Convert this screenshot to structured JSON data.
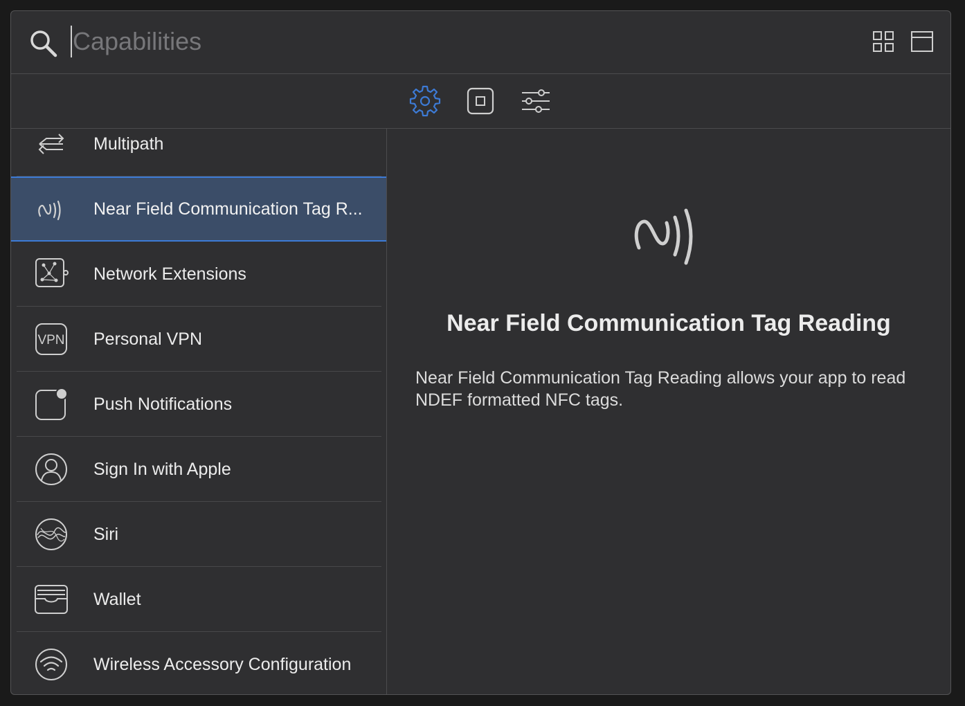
{
  "search": {
    "placeholder": "Capabilities",
    "value": ""
  },
  "toolbar": {
    "view_icons": [
      "grid-view-icon",
      "single-view-icon"
    ],
    "tabs": [
      {
        "name": "capabilities",
        "icon": "gear-icon",
        "active": true
      },
      {
        "name": "objects",
        "icon": "square-object-icon",
        "active": false
      },
      {
        "name": "attributes",
        "icon": "sliders-icon",
        "active": false
      }
    ]
  },
  "capabilities": [
    {
      "label": "Multipath",
      "icon": "multipath-arrows-icon"
    },
    {
      "label": "Near Field Communication Tag R...",
      "icon": "nfc-icon",
      "selected": true
    },
    {
      "label": "Network Extensions",
      "icon": "network-extensions-icon"
    },
    {
      "label": "Personal VPN",
      "icon": "vpn-icon",
      "icon_text": "VPN"
    },
    {
      "label": "Push Notifications",
      "icon": "push-notifications-icon"
    },
    {
      "label": "Sign In with Apple",
      "icon": "person-icon"
    },
    {
      "label": "Siri",
      "icon": "siri-icon"
    },
    {
      "label": "Wallet",
      "icon": "wallet-icon"
    },
    {
      "label": "Wireless Accessory Configuration",
      "icon": "wireless-icon"
    }
  ],
  "detail": {
    "icon": "nfc-icon",
    "title": "Near Field Communication Tag Reading",
    "description": "Near Field Communication Tag Reading allows your app to read NDEF formatted NFC tags."
  },
  "colors": {
    "accent": "#3d7bd6",
    "selected_row": "#3b4d68",
    "background": "#2f2f31"
  }
}
